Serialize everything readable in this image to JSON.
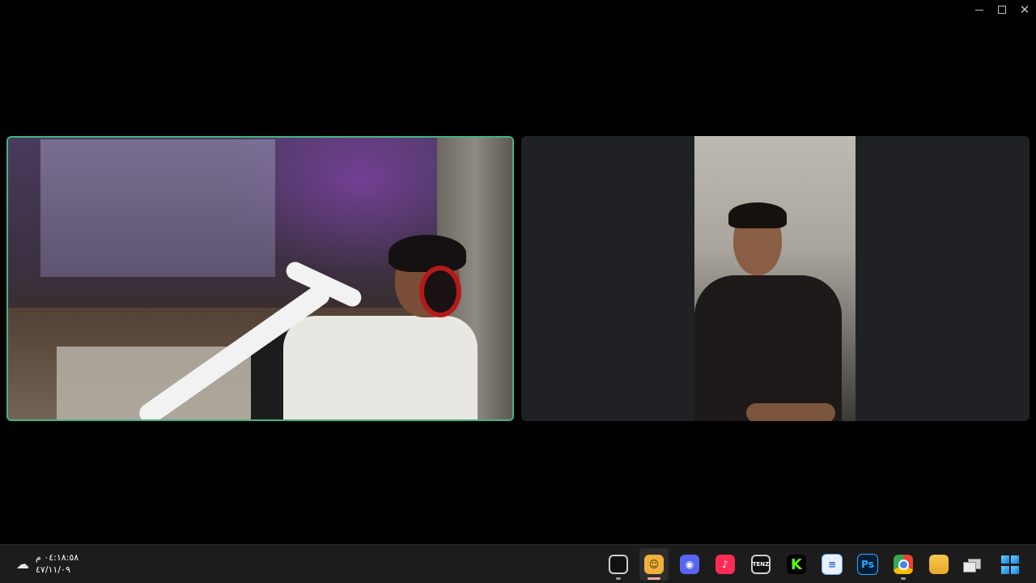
{
  "window": {
    "minimize_icon": "minimize-icon",
    "maximize_icon": "maximize-icon",
    "close_icon": "close-icon",
    "close_glyph": "✕"
  },
  "video_tiles": [
    {
      "type": "camera",
      "speaking": true,
      "accent_color": "#43b581"
    },
    {
      "type": "camera",
      "speaking": false
    }
  ],
  "taskbar": {
    "clock": {
      "time": "٠٤:١٨:٥٨ م",
      "date": "٤٧/١١/٠٩",
      "weather_icon": "weather-icon"
    },
    "apps": [
      {
        "name": "obs-icon",
        "glyph": "",
        "running": true,
        "active": false
      },
      {
        "name": "bot-icon",
        "glyph": "☺",
        "running": true,
        "active": true
      },
      {
        "name": "discord-icon",
        "glyph": "◉",
        "running": false,
        "active": false
      },
      {
        "name": "tiktok-icon",
        "glyph": "♪",
        "running": false,
        "active": false
      },
      {
        "name": "tenz-icon",
        "glyph": "TENZ",
        "running": false,
        "active": false
      },
      {
        "name": "kick-icon",
        "glyph": "K",
        "running": false,
        "active": false
      },
      {
        "name": "notepad-icon",
        "glyph": "≡",
        "running": false,
        "active": false
      },
      {
        "name": "photoshop-icon",
        "glyph": "Ps",
        "running": false,
        "active": false
      },
      {
        "name": "chrome-icon",
        "glyph": "",
        "running": true,
        "active": false
      },
      {
        "name": "file-explorer-icon",
        "glyph": "",
        "running": false,
        "active": false
      },
      {
        "name": "task-view-icon",
        "glyph": "",
        "running": false,
        "active": false
      },
      {
        "name": "start-icon",
        "glyph": "",
        "running": false,
        "active": false
      }
    ]
  }
}
